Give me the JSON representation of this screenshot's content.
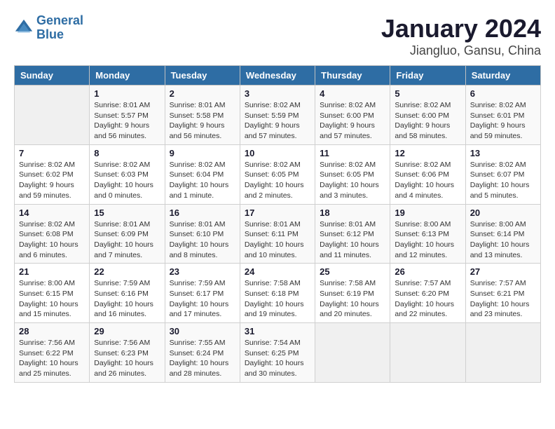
{
  "logo": {
    "line1": "General",
    "line2": "Blue"
  },
  "title": "January 2024",
  "subtitle": "Jiangluo, Gansu, China",
  "headers": [
    "Sunday",
    "Monday",
    "Tuesday",
    "Wednesday",
    "Thursday",
    "Friday",
    "Saturday"
  ],
  "weeks": [
    [
      {
        "day": "",
        "info": ""
      },
      {
        "day": "1",
        "info": "Sunrise: 8:01 AM\nSunset: 5:57 PM\nDaylight: 9 hours\nand 56 minutes."
      },
      {
        "day": "2",
        "info": "Sunrise: 8:01 AM\nSunset: 5:58 PM\nDaylight: 9 hours\nand 56 minutes."
      },
      {
        "day": "3",
        "info": "Sunrise: 8:02 AM\nSunset: 5:59 PM\nDaylight: 9 hours\nand 57 minutes."
      },
      {
        "day": "4",
        "info": "Sunrise: 8:02 AM\nSunset: 6:00 PM\nDaylight: 9 hours\nand 57 minutes."
      },
      {
        "day": "5",
        "info": "Sunrise: 8:02 AM\nSunset: 6:00 PM\nDaylight: 9 hours\nand 58 minutes."
      },
      {
        "day": "6",
        "info": "Sunrise: 8:02 AM\nSunset: 6:01 PM\nDaylight: 9 hours\nand 59 minutes."
      }
    ],
    [
      {
        "day": "7",
        "info": "Sunrise: 8:02 AM\nSunset: 6:02 PM\nDaylight: 9 hours\nand 59 minutes."
      },
      {
        "day": "8",
        "info": "Sunrise: 8:02 AM\nSunset: 6:03 PM\nDaylight: 10 hours\nand 0 minutes."
      },
      {
        "day": "9",
        "info": "Sunrise: 8:02 AM\nSunset: 6:04 PM\nDaylight: 10 hours\nand 1 minute."
      },
      {
        "day": "10",
        "info": "Sunrise: 8:02 AM\nSunset: 6:05 PM\nDaylight: 10 hours\nand 2 minutes."
      },
      {
        "day": "11",
        "info": "Sunrise: 8:02 AM\nSunset: 6:05 PM\nDaylight: 10 hours\nand 3 minutes."
      },
      {
        "day": "12",
        "info": "Sunrise: 8:02 AM\nSunset: 6:06 PM\nDaylight: 10 hours\nand 4 minutes."
      },
      {
        "day": "13",
        "info": "Sunrise: 8:02 AM\nSunset: 6:07 PM\nDaylight: 10 hours\nand 5 minutes."
      }
    ],
    [
      {
        "day": "14",
        "info": "Sunrise: 8:02 AM\nSunset: 6:08 PM\nDaylight: 10 hours\nand 6 minutes."
      },
      {
        "day": "15",
        "info": "Sunrise: 8:01 AM\nSunset: 6:09 PM\nDaylight: 10 hours\nand 7 minutes."
      },
      {
        "day": "16",
        "info": "Sunrise: 8:01 AM\nSunset: 6:10 PM\nDaylight: 10 hours\nand 8 minutes."
      },
      {
        "day": "17",
        "info": "Sunrise: 8:01 AM\nSunset: 6:11 PM\nDaylight: 10 hours\nand 10 minutes."
      },
      {
        "day": "18",
        "info": "Sunrise: 8:01 AM\nSunset: 6:12 PM\nDaylight: 10 hours\nand 11 minutes."
      },
      {
        "day": "19",
        "info": "Sunrise: 8:00 AM\nSunset: 6:13 PM\nDaylight: 10 hours\nand 12 minutes."
      },
      {
        "day": "20",
        "info": "Sunrise: 8:00 AM\nSunset: 6:14 PM\nDaylight: 10 hours\nand 13 minutes."
      }
    ],
    [
      {
        "day": "21",
        "info": "Sunrise: 8:00 AM\nSunset: 6:15 PM\nDaylight: 10 hours\nand 15 minutes."
      },
      {
        "day": "22",
        "info": "Sunrise: 7:59 AM\nSunset: 6:16 PM\nDaylight: 10 hours\nand 16 minutes."
      },
      {
        "day": "23",
        "info": "Sunrise: 7:59 AM\nSunset: 6:17 PM\nDaylight: 10 hours\nand 17 minutes."
      },
      {
        "day": "24",
        "info": "Sunrise: 7:58 AM\nSunset: 6:18 PM\nDaylight: 10 hours\nand 19 minutes."
      },
      {
        "day": "25",
        "info": "Sunrise: 7:58 AM\nSunset: 6:19 PM\nDaylight: 10 hours\nand 20 minutes."
      },
      {
        "day": "26",
        "info": "Sunrise: 7:57 AM\nSunset: 6:20 PM\nDaylight: 10 hours\nand 22 minutes."
      },
      {
        "day": "27",
        "info": "Sunrise: 7:57 AM\nSunset: 6:21 PM\nDaylight: 10 hours\nand 23 minutes."
      }
    ],
    [
      {
        "day": "28",
        "info": "Sunrise: 7:56 AM\nSunset: 6:22 PM\nDaylight: 10 hours\nand 25 minutes."
      },
      {
        "day": "29",
        "info": "Sunrise: 7:56 AM\nSunset: 6:23 PM\nDaylight: 10 hours\nand 26 minutes."
      },
      {
        "day": "30",
        "info": "Sunrise: 7:55 AM\nSunset: 6:24 PM\nDaylight: 10 hours\nand 28 minutes."
      },
      {
        "day": "31",
        "info": "Sunrise: 7:54 AM\nSunset: 6:25 PM\nDaylight: 10 hours\nand 30 minutes."
      },
      {
        "day": "",
        "info": ""
      },
      {
        "day": "",
        "info": ""
      },
      {
        "day": "",
        "info": ""
      }
    ]
  ]
}
